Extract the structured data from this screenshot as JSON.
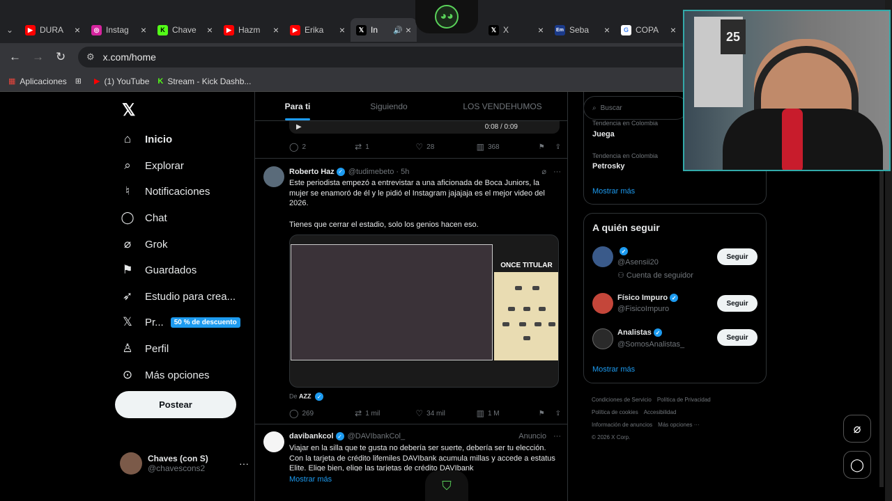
{
  "browser": {
    "tabs": [
      {
        "title": "DURA",
        "fav_color": "#ff0000",
        "fav_glyph": "▶"
      },
      {
        "title": "Instag",
        "fav_color": "#d6249f",
        "fav_glyph": "◎"
      },
      {
        "title": "Chave",
        "fav_color": "#53fc18",
        "fav_glyph": "K"
      },
      {
        "title": "Hazm",
        "fav_color": "#ff0000",
        "fav_glyph": "▶"
      },
      {
        "title": "Erika",
        "fav_color": "#ff0000",
        "fav_glyph": "▶"
      },
      {
        "title": "In",
        "fav_color": "#000000",
        "fav_glyph": "𝕏",
        "active": true,
        "audio": "🔊"
      },
      {
        "title": "",
        "fav_color": "#000000",
        "fav_glyph": "𝕏"
      },
      {
        "title": "X",
        "fav_color": "#000000",
        "fav_glyph": "𝕏"
      },
      {
        "title": "Seba",
        "fav_color": "#1a3a8a",
        "fav_glyph": "Em"
      },
      {
        "title": "COPA",
        "fav_color": "#ffffff",
        "fav_glyph": "G"
      }
    ],
    "url": "x.com/home",
    "bookmarks": [
      {
        "label": "Aplicaciones",
        "icon": "apps-grid-icon"
      },
      {
        "label": "(1) YouTube",
        "icon": "youtube-icon"
      },
      {
        "label": "Stream - Kick Dashb...",
        "icon": "kick-icon"
      }
    ]
  },
  "nav": {
    "items": [
      {
        "label": "Inicio",
        "icon": "home-icon",
        "glyph": "⌂",
        "bold": true
      },
      {
        "label": "Explorar",
        "icon": "search-icon",
        "glyph": "⌕"
      },
      {
        "label": "Notificaciones",
        "icon": "bell-icon",
        "glyph": "🔔"
      },
      {
        "label": "Chat",
        "icon": "chat-icon",
        "glyph": "◯"
      },
      {
        "label": "Grok",
        "icon": "grok-icon",
        "glyph": "⌀"
      },
      {
        "label": "Guardados",
        "icon": "bookmark-icon",
        "glyph": "⚑"
      },
      {
        "label": "Estudio para crea...",
        "icon": "rocket-icon",
        "glyph": "➶"
      },
      {
        "label": "Pr...",
        "icon": "x-premium-icon",
        "glyph": "𝕏",
        "badge": "50 % de descuento"
      },
      {
        "label": "Perfil",
        "icon": "profile-icon",
        "glyph": "♙"
      },
      {
        "label": "Más opciones",
        "icon": "more-options-icon",
        "glyph": "⋯"
      }
    ],
    "post_label": "Postear",
    "account": {
      "name": "Chaves (con S)",
      "handle": "@chavescons2"
    }
  },
  "feed": {
    "tabs": [
      "Para ti",
      "Siguiendo",
      "LOS VENDEHUMOS"
    ],
    "video_time": "0:08 / 0:09",
    "prev_actions": {
      "replies": "2",
      "reposts": "1",
      "likes": "28",
      "views": "368"
    },
    "tweet": {
      "name": "Roberto Haz",
      "handle": "@tudimebeto · 5h",
      "text1": "Este periodista empezó a entrevistar a una aficionada de Boca Juniors, la mujer se enamoró de él y le pidió el Instagram jajajaja es el mejor video del 2026.",
      "text2": "Tienes que cerrar el estadio, solo los genios hacen eso.",
      "lineup_title": "ONCE TITULAR",
      "from_prefix": "De",
      "from_name": "AZZ",
      "actions": {
        "replies": "269",
        "reposts": "1 mil",
        "likes": "34 mil",
        "views": "1 M"
      }
    },
    "ad": {
      "name": "davibankcol",
      "handle": "@DAVIbankCol_",
      "label": "Anuncio",
      "text": "Viajar en la silla que te gusta no debería ser suerte, debería ser tu elección. Con la tarjeta de crédito lifemiles DAVIbank acumula millas y accede a estatus Elite. Elige bien, elige las tarjetas de crédito DAVIbank",
      "more": "Mostrar más"
    }
  },
  "sidebar": {
    "search_placeholder": "Buscar",
    "trends": [
      {
        "meta": "Tendencia en Colombia",
        "name": "Juega"
      },
      {
        "meta": "Tendencia en Colombia",
        "name": "Petrosky"
      }
    ],
    "trends_more": "Mostrar más",
    "follow_title": "A quién seguir",
    "follow": [
      {
        "name": "",
        "handle": "@Asensii20",
        "note": "Cuenta de seguidor",
        "btn": "Seguir",
        "color": "#3a5a8a"
      },
      {
        "name": "Físico Impuro",
        "handle": "@FisicoImpuro",
        "note": "",
        "btn": "Seguir",
        "color": "#c4463a"
      },
      {
        "name": "Analistas",
        "handle": "@SomosAnalistas_",
        "note": "",
        "btn": "Seguir",
        "color": "#2a2a2a"
      }
    ],
    "follow_more": "Mostrar más",
    "footer": [
      "Condiciones de Servicio",
      "Política de Privacidad",
      "Política de cookies",
      "Accesibilidad",
      "Información de anuncios",
      "Más opciones ···",
      "© 2026 X Corp."
    ]
  },
  "overlay": {
    "jersey_number": "25"
  }
}
